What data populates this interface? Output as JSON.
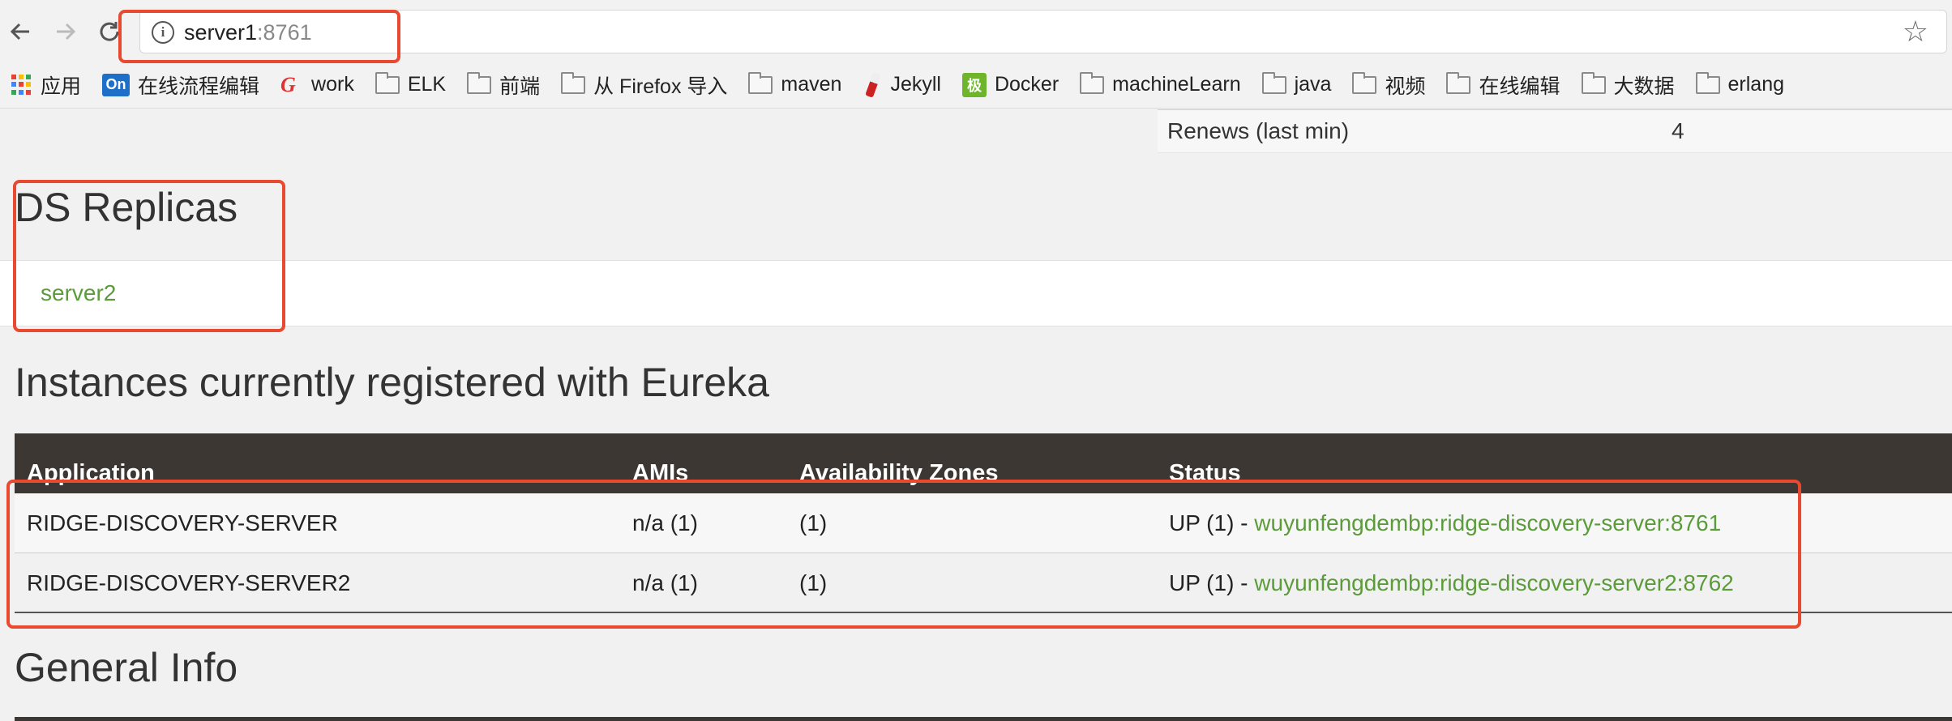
{
  "browser": {
    "url_host": "server1",
    "url_port": ":8761",
    "back_icon": "arrow-left-icon",
    "forward_icon": "arrow-right-icon",
    "reload_icon": "reload-icon",
    "info_icon": "i",
    "star_icon": "☆"
  },
  "bookmarks": {
    "apps": "应用",
    "items": [
      "在线流程编辑",
      "work",
      "ELK",
      "前端",
      "从 Firefox 导入",
      "maven",
      "Jekyll",
      "Docker",
      "machineLearn",
      "java",
      "视频",
      "在线编辑",
      "大数据",
      "erlang"
    ],
    "on_badge": "On",
    "g_badge": "G",
    "docker_badge": "极"
  },
  "stats": {
    "renews_label": "Renews (last min)",
    "renews_value": "4"
  },
  "replicas": {
    "heading": "DS Replicas",
    "link": "server2"
  },
  "instances": {
    "heading": "Instances currently registered with Eureka",
    "columns": [
      "Application",
      "AMIs",
      "Availability Zones",
      "Status"
    ],
    "rows": [
      {
        "application": "RIDGE-DISCOVERY-SERVER",
        "amis": "n/a (1)",
        "zones": "(1)",
        "status": "UP (1) - ",
        "instance": "wuyunfengdembp:ridge-discovery-server:8761"
      },
      {
        "application": "RIDGE-DISCOVERY-SERVER2",
        "amis": "n/a (1)",
        "zones": "(1)",
        "status": "UP (1) - ",
        "instance": "wuyunfengdembp:ridge-discovery-server2:8762"
      }
    ]
  },
  "general": {
    "heading": "General Info"
  },
  "colors": {
    "link": "#5b9b3a",
    "table_header": "#3d3734",
    "highlight": "#e8492f"
  }
}
